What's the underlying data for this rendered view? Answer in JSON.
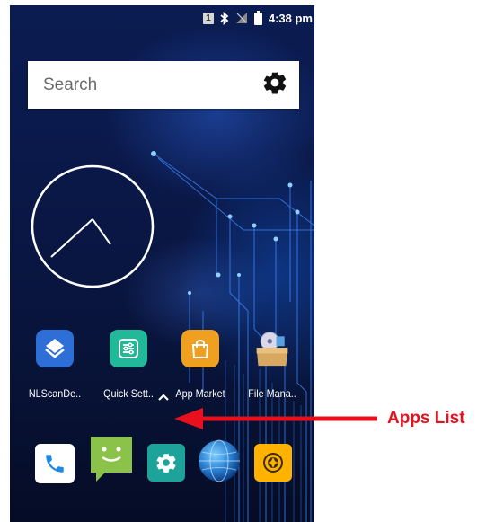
{
  "status_bar": {
    "sim_label": "1",
    "time": "4:38 pm",
    "icons": [
      "sim-1-icon",
      "bluetooth-icon",
      "no-signal-icon",
      "battery-icon"
    ]
  },
  "search": {
    "placeholder": "Search",
    "settings_icon": "gear-icon"
  },
  "clock": {
    "type": "analog",
    "hour_hand_icon": "clock-hour-hand",
    "minute_hand_icon": "clock-minute-hand"
  },
  "apps": [
    {
      "label": "NLScanDe..",
      "icon": "nlscan-icon",
      "color": "#2d6fd6"
    },
    {
      "label": "Quick Sett..",
      "icon": "quick-settings-icon",
      "color": "#22b89a"
    },
    {
      "label": "App Market",
      "icon": "shopping-bag-icon",
      "color": "#f0a020"
    },
    {
      "label": "File Mana..",
      "icon": "file-manager-icon",
      "color": "#d9a860"
    }
  ],
  "drawer_handle_icon": "chevron-up-icon",
  "dock": [
    {
      "icon": "phone-icon",
      "color": "#ffffff"
    },
    {
      "icon": "messaging-icon",
      "color": "#8bc34a"
    },
    {
      "icon": "settings-icon",
      "color": "#1ea39b"
    },
    {
      "icon": "browser-globe-icon",
      "color": "#2a7fd0"
    },
    {
      "icon": "camera-icon",
      "color": "#ffb300"
    }
  ],
  "annotation": {
    "label": "Apps List",
    "color": "#e8101c"
  }
}
